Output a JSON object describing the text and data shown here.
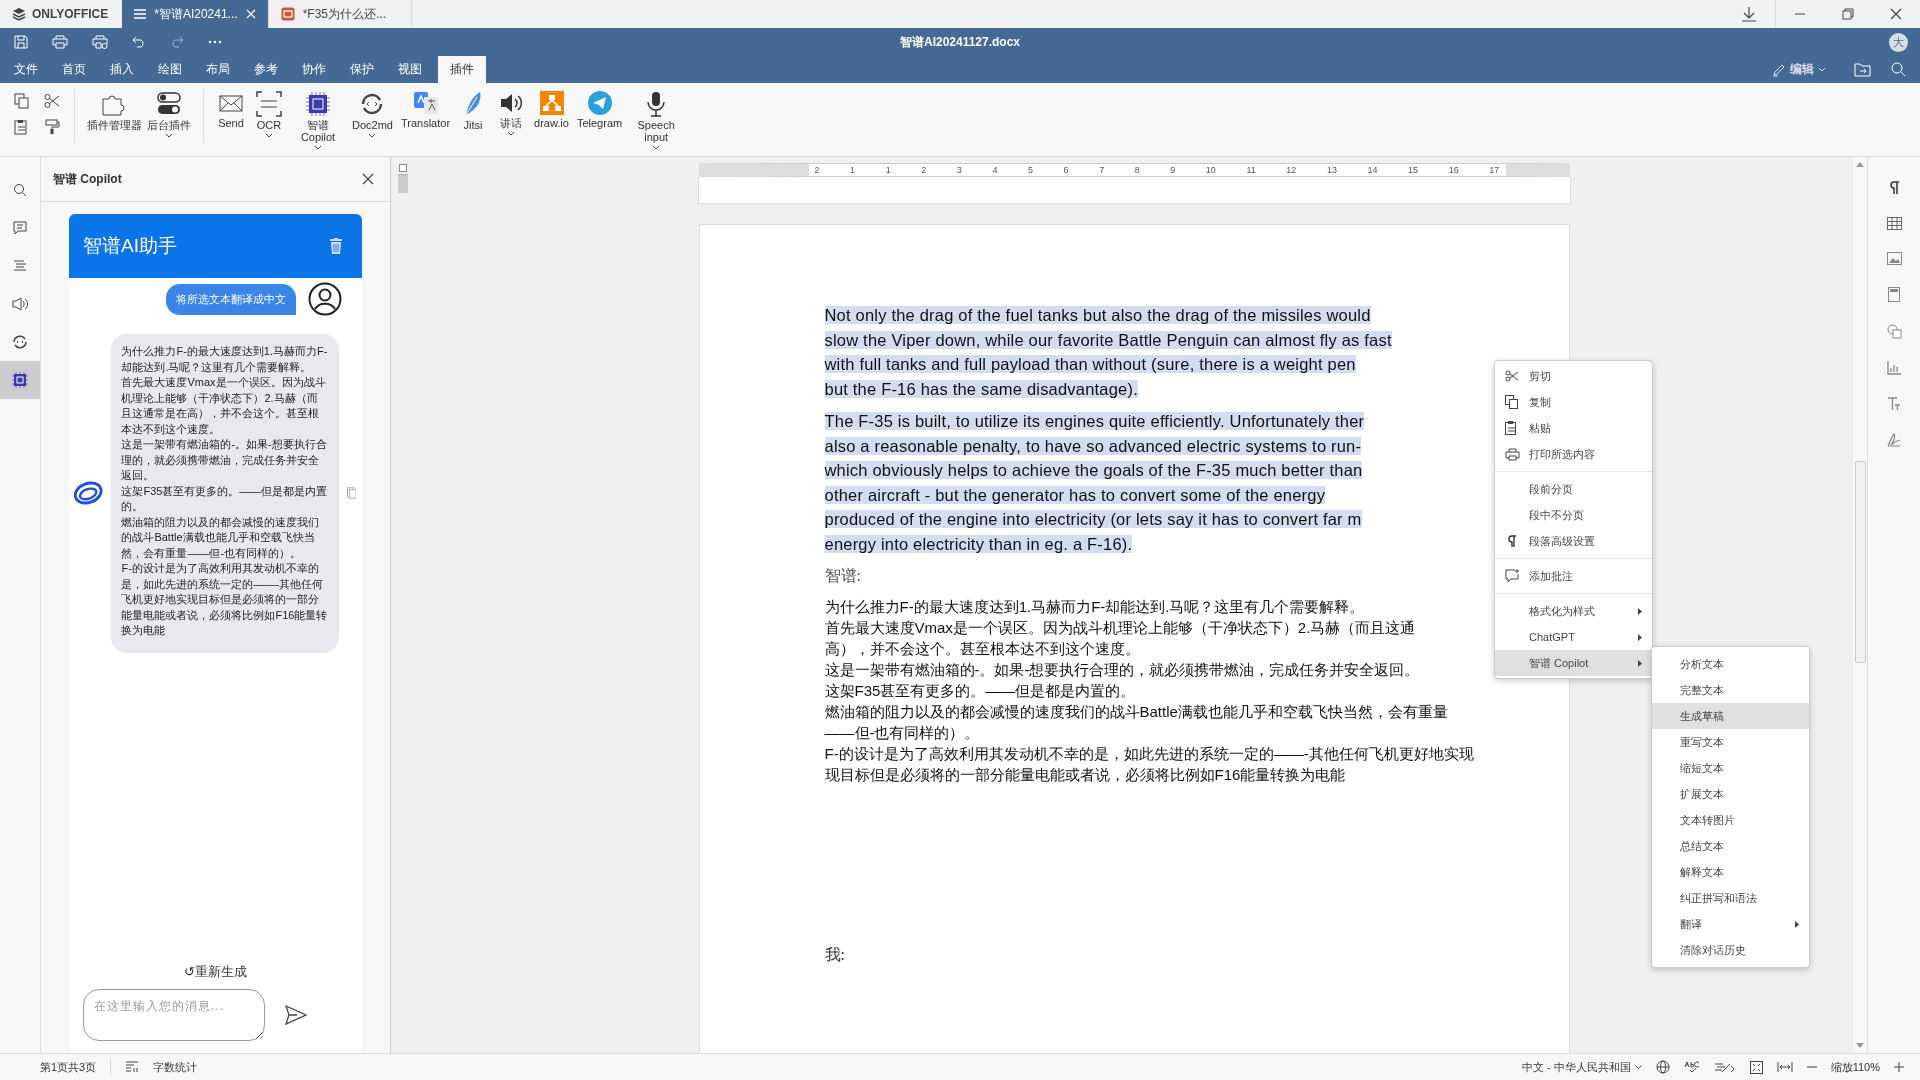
{
  "app": {
    "name": "ONLYOFFICE"
  },
  "tabs": [
    {
      "label": "*智谱AI20241...",
      "kind": "document",
      "selected": true
    },
    {
      "label": "*F35为什么还...",
      "kind": "presentation",
      "selected": false
    }
  ],
  "header": {
    "title": "智谱AI20241127.docx",
    "avatar": "大"
  },
  "menu_tabs": [
    {
      "label": "文件",
      "selected": false
    },
    {
      "label": "首页",
      "selected": false
    },
    {
      "label": "插入",
      "selected": false
    },
    {
      "label": "绘图",
      "selected": false
    },
    {
      "label": "布局",
      "selected": false
    },
    {
      "label": "参考",
      "selected": false
    },
    {
      "label": "协作",
      "selected": false
    },
    {
      "label": "保护",
      "selected": false
    },
    {
      "label": "视图",
      "selected": false
    },
    {
      "label": "插件",
      "selected": true
    }
  ],
  "edit_button": "编辑",
  "toolbar": [
    [
      {
        "label": "插件管理器",
        "kind": "puzzle",
        "caret": false
      },
      {
        "label": "后台插件",
        "kind": "toggles",
        "caret": true
      }
    ],
    [
      {
        "label": "Send",
        "kind": "mail",
        "caret": false
      },
      {
        "label": "OCR",
        "kind": "ocr",
        "caret": true
      },
      {
        "label": "智谱 Copilot",
        "kind": "ai",
        "caret": true
      },
      {
        "label": "Doc2md",
        "kind": "doc2md",
        "caret": true
      },
      {
        "label": "Translator",
        "kind": "translate",
        "caret": false
      },
      {
        "label": "Jitsi",
        "kind": "jitsi",
        "caret": false
      },
      {
        "label": "讲话",
        "kind": "speaker",
        "caret": true
      },
      {
        "label": "draw.io",
        "kind": "drawio",
        "caret": false
      },
      {
        "label": "Telegram",
        "kind": "telegram",
        "caret": false
      },
      {
        "label": "Speech input",
        "kind": "mic",
        "caret": true
      }
    ]
  ],
  "left_bar": [
    {
      "kind": "search",
      "selected": false
    },
    {
      "kind": "comment",
      "selected": false
    },
    {
      "kind": "headings",
      "selected": false
    },
    {
      "kind": "speaker",
      "selected": false
    },
    {
      "kind": "doc2md",
      "selected": false
    },
    {
      "kind": "ai",
      "selected": true
    }
  ],
  "panel": {
    "title": "智谱 Copilot",
    "assistant_title": "智谱AI助手",
    "user_message": "将所选文本翻译成中文",
    "reply": [
      "为什么推力F-的最大速度达到1.马赫而力F-却能达到.马呢？这里有几个需要解释。",
      "首先最大速度Vmax是一个误区。因为战斗机理论上能够（干净状态下）2.马赫（而且这通常是在高），并不会这个。甚至根本达不到这个速度。",
      "这是一架带有燃油箱的-。如果-想要执行合理的，就必须携带燃油，完成任务并安全返回。",
      "这架F35甚至有更多的。——但是都是内置的。",
      "燃油箱的阻力以及的都会减慢的速度我们的战斗Battle满载也能几乎和空载飞快当然，会有重量——但-也有同样的）。",
      "F-的设计是为了高效利用其发动机不幸的是，如此先进的系统一定的——-其他任何飞机更好地实现目标但是必须将的一部分能量电能或者说，必须将比例如F16能量转换为电能"
    ],
    "regenerate": "↺重新生成",
    "input": {
      "placeholder": "在这里输入您的消息..."
    }
  },
  "ruler": {
    "labels": [
      "2",
      "1",
      "1",
      "2",
      "3",
      "4",
      "5",
      "6",
      "7",
      "8",
      "9",
      "10",
      "11",
      "12",
      "13",
      "14",
      "15",
      "16",
      "17"
    ]
  },
  "document": {
    "paragraphs": [
      {
        "kind": "english",
        "selected": true,
        "lines": [
          "Not only the drag of the fuel tanks but also the drag of the missiles would",
          "slow the Viper down, while our favorite Battle Penguin can almost fly as fast",
          "with full tanks and full payload than without (sure, there is a weight pen",
          "but the F-16 has the same disadvantage)."
        ]
      },
      {
        "kind": "english",
        "selected": true,
        "lines": [
          "The F-35 is built, to utilize its engines quite efficiently. Unfortunately ther",
          "also a reasonable penalty, to have so advanced electric systems to run-",
          "which obviously helps to achieve the goals of the F-35 much better than",
          "other aircraft - but the generator has to convert some of the energy",
          "produced of the engine into electricity (or lets say it has to convert far m",
          "energy into electricity than in eg. a F-16)."
        ]
      },
      {
        "kind": "label",
        "selected": false,
        "lines": [
          "智谱:"
        ]
      },
      {
        "kind": "chinese",
        "selected": false,
        "lines": [
          "为什么推力F-的最大速度达到1.马赫而力F-却能达到.马呢？这里有几个需要解释。",
          "首先最大速度Vmax是一个误区。因为战斗机理论上能够（干净状态下）2.马赫（而且这通",
          "高），并不会这个。甚至根本达不到这个速度。",
          "这是一架带有燃油箱的-。如果-想要执行合理的，就必须携带燃油，完成任务并安全返回。",
          "这架F35甚至有更多的。——但是都是内置的。",
          "燃油箱的阻力以及的都会减慢的速度我们的战斗Battle满载也能几乎和空载飞快当然，会有重量",
          "——但-也有同样的）。",
          "F-的设计是为了高效利用其发动机不幸的是，如此先进的系统一定的——-其他任何飞机更好地实现",
          "现目标但是必须将的一部分能量电能或者说，必须将比例如F16能量转换为电能"
        ]
      },
      {
        "kind": "label_far",
        "selected": false,
        "lines": [
          "我:"
        ]
      }
    ]
  },
  "context_menu": {
    "groups": [
      [
        {
          "label": "剪切",
          "kind": "cut",
          "submenu": false,
          "selected": false
        },
        {
          "label": "复制",
          "kind": "copy",
          "submenu": false,
          "selected": false
        },
        {
          "label": "粘贴",
          "kind": "paste",
          "submenu": false,
          "selected": false
        },
        {
          "label": "打印所选内容",
          "kind": "print",
          "submenu": false,
          "selected": false
        }
      ],
      [
        {
          "label": "段前分页",
          "kind": "plain",
          "submenu": false,
          "selected": false
        },
        {
          "label": "段中不分页",
          "kind": "plain",
          "submenu": false,
          "selected": false
        },
        {
          "label": "段落高级设置",
          "kind": "paragraph",
          "submenu": false,
          "selected": false
        }
      ],
      [
        {
          "label": "添加批注",
          "kind": "comment",
          "submenu": false,
          "selected": false
        }
      ],
      [
        {
          "label": "格式化为样式",
          "kind": "plain",
          "submenu": true,
          "selected": false
        },
        {
          "label": "ChatGPT",
          "kind": "plain",
          "submenu": true,
          "selected": false
        },
        {
          "label": "智谱 Copilot",
          "kind": "plain",
          "submenu": true,
          "selected": true
        }
      ]
    ]
  },
  "submenu": [
    {
      "label": "分析文本",
      "submenu": false,
      "selected": false
    },
    {
      "label": "完整文本",
      "submenu": false,
      "selected": false
    },
    {
      "label": "生成草稿",
      "submenu": false,
      "selected": true
    },
    {
      "label": "重写文本",
      "submenu": false,
      "selected": false
    },
    {
      "label": "缩短文本",
      "submenu": false,
      "selected": false
    },
    {
      "label": "扩展文本",
      "submenu": false,
      "selected": false
    },
    {
      "label": "文本转图片",
      "submenu": false,
      "selected": false
    },
    {
      "label": "总结文本",
      "submenu": false,
      "selected": false
    },
    {
      "label": "解释文本",
      "submenu": false,
      "selected": false
    },
    {
      "label": "纠正拼写和语法",
      "submenu": false,
      "selected": false
    },
    {
      "label": "翻译",
      "submenu": true,
      "selected": false
    },
    {
      "label": "清除对话历史",
      "submenu": false,
      "selected": false
    }
  ],
  "right_bar": [
    {
      "kind": "pilcrow"
    },
    {
      "kind": "table"
    },
    {
      "kind": "image"
    },
    {
      "kind": "header"
    },
    {
      "kind": "shape"
    },
    {
      "kind": "chart"
    },
    {
      "kind": "textart"
    },
    {
      "kind": "signature"
    }
  ],
  "status_bar": {
    "page": "第1页共3页",
    "word_count": "字数统计",
    "language": "中文 - 中华人民共和国",
    "zoom": "缩放110%"
  }
}
